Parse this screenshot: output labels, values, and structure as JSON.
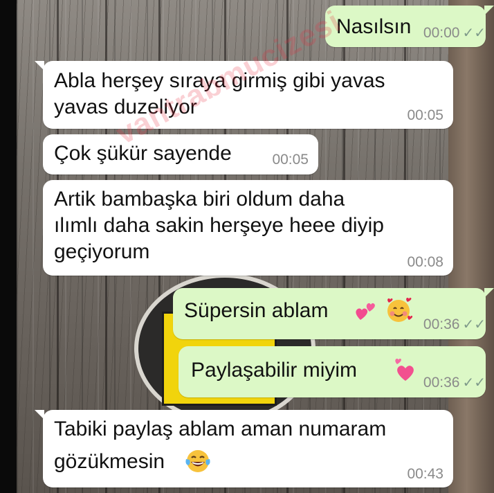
{
  "messages": [
    {
      "id": "m1",
      "direction": "outgoing",
      "text": "Nasılsın",
      "time": "00:00",
      "status": "read-ticks"
    },
    {
      "id": "m2",
      "direction": "incoming",
      "line1": "Abla herşey sıraya girmiş gibi yavas",
      "line2": "yavas duzeliyor",
      "time": "00:05"
    },
    {
      "id": "m3",
      "direction": "incoming",
      "text": "Çok şükür sayende",
      "time": "00:05"
    },
    {
      "id": "m4",
      "direction": "incoming",
      "line1": "Artik bambaşka biri oldum daha",
      "line2": "ılımlı daha sakin herşeye heee diyip",
      "line3": "geçiyorum",
      "time": "00:08"
    },
    {
      "id": "m5",
      "direction": "outgoing",
      "text": "Süpersin ablam",
      "emojis": [
        "two-hearts-icon",
        "smiling-face-with-hearts-icon"
      ],
      "time": "00:36",
      "status": "read-ticks"
    },
    {
      "id": "m6",
      "direction": "outgoing",
      "text": "Paylaşabilir miyim",
      "emojis": [
        "revolving-hearts-icon"
      ],
      "time": "00:36",
      "status": "read-ticks"
    },
    {
      "id": "m7",
      "direction": "incoming",
      "line1": "Tabiki paylaş ablam aman numaram",
      "line2": "gözükmesin",
      "emojis": [
        "face-with-tears-of-joy-icon"
      ],
      "time": "00:43"
    }
  ],
  "ticks_symbol": "✓✓",
  "watermark": "vantrabmucizesi",
  "colors": {
    "incoming_bubble": "#ffffff",
    "outgoing_bubble": "#dcf8c6",
    "timestamp": "#8a8a8a"
  }
}
